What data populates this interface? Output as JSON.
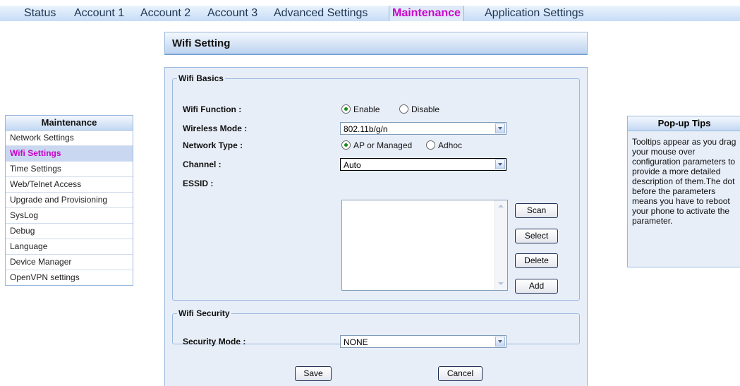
{
  "nav": {
    "tabs": [
      "Status",
      "Account 1",
      "Account 2",
      "Account 3",
      "Advanced Settings",
      "Maintenance",
      "Application Settings"
    ],
    "active": "Maintenance"
  },
  "sidebar": {
    "title": "Maintenance",
    "items": [
      "Network Settings",
      "Wifi Settings",
      "Time Settings",
      "Web/Telnet Access",
      "Upgrade and Provisioning",
      "SysLog",
      "Debug",
      "Language",
      "Device Manager",
      "OpenVPN settings"
    ],
    "active": "Wifi Settings"
  },
  "page": {
    "title": "Wifi Setting"
  },
  "wifi_basics": {
    "legend": "Wifi Basics",
    "function_label": "Wifi Function :",
    "function_options": [
      "Enable",
      "Disable"
    ],
    "function_selected": "Enable",
    "mode_label": "Wireless Mode :",
    "mode_value": "802.11b/g/n",
    "network_type_label": "Network Type :",
    "network_type_options": [
      "AP or Managed",
      "Adhoc"
    ],
    "network_type_selected": "AP or Managed",
    "channel_label": "Channel :",
    "channel_value": "Auto",
    "essid_label": "ESSID :",
    "buttons": {
      "scan": "Scan",
      "select": "Select",
      "delete": "Delete",
      "add": "Add"
    }
  },
  "wifi_security": {
    "legend": "Wifi Security",
    "mode_label": "Security Mode :",
    "mode_value": "NONE"
  },
  "actions": {
    "save": "Save",
    "cancel": "Cancel"
  },
  "tips": {
    "title": "Pop-up Tips",
    "text": "Tooltips appear as you drag your mouse over configuration parameters to provide a more detailed description of them.The dot before the parameters means you have to reboot your phone to activate the parameter."
  },
  "colors": {
    "active_text": "#cc00cc",
    "panel_bg": "#e8eef8",
    "border": "#9ab8de"
  }
}
